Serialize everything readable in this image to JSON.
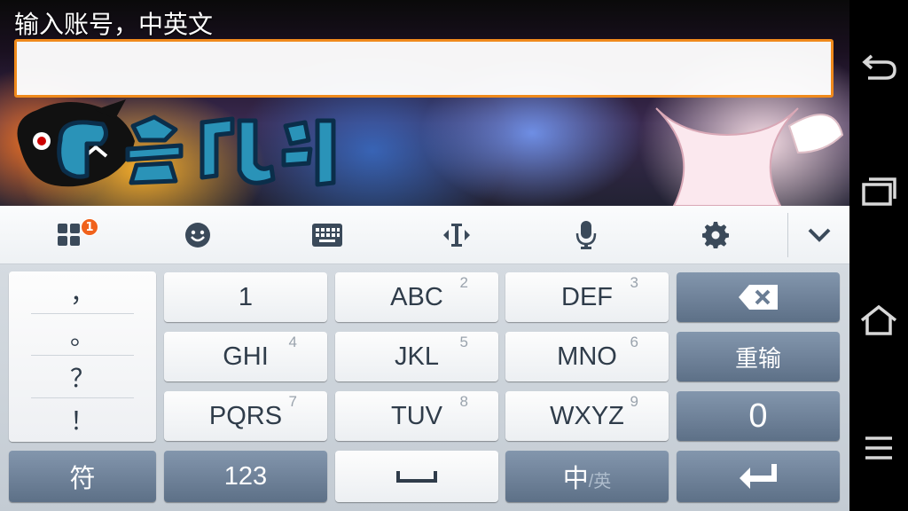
{
  "input": {
    "label": "输入账号，中英文",
    "value": "",
    "placeholder": ""
  },
  "toolbar": {
    "items": [
      {
        "icon": "apps-grid-icon",
        "badge": "1"
      },
      {
        "icon": "emoji-icon"
      },
      {
        "icon": "keyboard-icon"
      },
      {
        "icon": "cursor-move-icon"
      },
      {
        "icon": "microphone-icon"
      },
      {
        "icon": "settings-gear-icon"
      },
      {
        "icon": "collapse-chevron-icon"
      }
    ]
  },
  "keyboard": {
    "punctuation": [
      "，",
      "。",
      "？",
      "！"
    ],
    "rows": [
      {
        "keys": [
          {
            "label": "1",
            "sub": ""
          },
          {
            "label": "ABC",
            "sub": "2"
          },
          {
            "label": "DEF",
            "sub": "3"
          }
        ]
      },
      {
        "keys": [
          {
            "label": "GHI",
            "sub": "4"
          },
          {
            "label": "JKL",
            "sub": "5"
          },
          {
            "label": "MNO",
            "sub": "6"
          }
        ]
      },
      {
        "keys": [
          {
            "label": "PQRS",
            "sub": "7"
          },
          {
            "label": "TUV",
            "sub": "8"
          },
          {
            "label": "WXYZ",
            "sub": "9"
          }
        ]
      }
    ],
    "right_keys": {
      "backspace": "backspace-icon",
      "reinput": "重输",
      "zero": "0",
      "enter": "enter-icon"
    },
    "bottom_row": {
      "symbol": "符",
      "numbers": "123",
      "space": "space-icon",
      "lang_primary": "中",
      "lang_secondary": "/英"
    }
  },
  "nav_bar": {
    "icons": [
      "back-icon",
      "recent-apps-icon",
      "home-icon",
      "menu-icon"
    ]
  },
  "colors": {
    "input_border": "#f08a1c",
    "badge": "#f0621c",
    "dark_key": "#6b7e95",
    "light_key": "#f5f6f8"
  }
}
